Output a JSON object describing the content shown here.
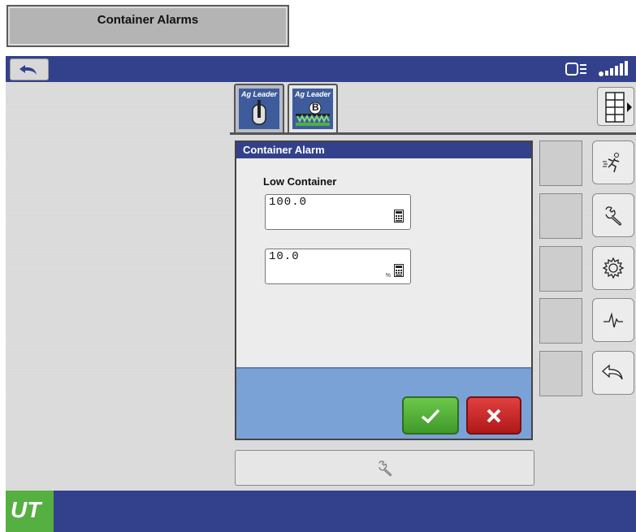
{
  "caption": {
    "title": "Container Alarms"
  },
  "tabs": [
    {
      "brand": "Ag Leader",
      "kind": "virtual-terminal"
    },
    {
      "brand": "Ag Leader",
      "letter": "B",
      "kind": "sprayer"
    }
  ],
  "dialog": {
    "title": "Container Alarm",
    "section_label": "Low Container",
    "fields": [
      {
        "value": "100.0",
        "unit": ""
      },
      {
        "value": "10.0",
        "unit": "%"
      }
    ]
  },
  "side_buttons": [
    "run-icon",
    "wrench-icon",
    "gear-icon",
    "diagnostic-icon",
    "back-icon"
  ],
  "logo": {
    "text": "UT"
  },
  "colors": {
    "bar": "#33418c",
    "ok": "#4caf32",
    "cancel": "#c82020",
    "logo": "#55b041"
  }
}
